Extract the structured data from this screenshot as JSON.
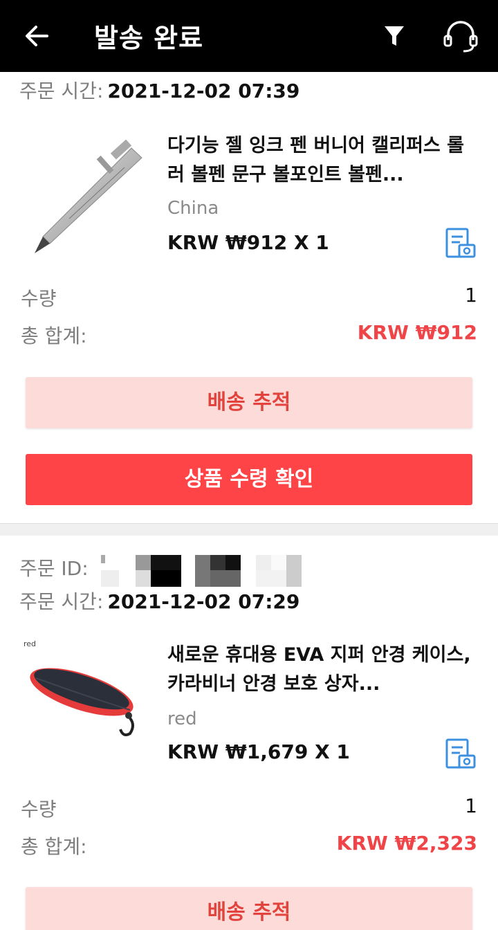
{
  "header": {
    "title": "발송 완료",
    "back_icon": "arrow-left-icon",
    "filter_icon": "filter-icon",
    "support_icon": "headset-icon"
  },
  "colors": {
    "header_bg": "#000000",
    "accent_red": "#fe4447",
    "track_bg": "#fddbd8",
    "total_red": "#ef4448"
  },
  "orders": [
    {
      "order_time_label": "주문 시간:",
      "order_time": "2021-12-02 07:39",
      "product_title": "다기능 젤 잉크 펜 버니어 캘리퍼스 롤러 볼펜 문구 볼포인트 볼펜...",
      "variant": "China",
      "price_line": "KRW ₩912 X 1",
      "quantity_label": "수량",
      "quantity": "1",
      "total_label": "총 합계:",
      "total": "KRW ₩912",
      "track_label": "배송 추적",
      "confirm_label": "상품 수령 확인"
    },
    {
      "order_id_label": "주문 ID:",
      "order_time_label": "주문 시간:",
      "order_time": "2021-12-02 07:29",
      "image_tag": "red",
      "product_title": "새로운 휴대용 EVA 지퍼 안경 케이스, 카라비너 안경 보호 상자...",
      "variant": "red",
      "price_line": "KRW ₩1,679 X 1",
      "quantity_label": "수량",
      "quantity": "1",
      "total_label": "총 합계:",
      "total": "KRW ₩2,323",
      "track_label": "배송 추적"
    }
  ]
}
